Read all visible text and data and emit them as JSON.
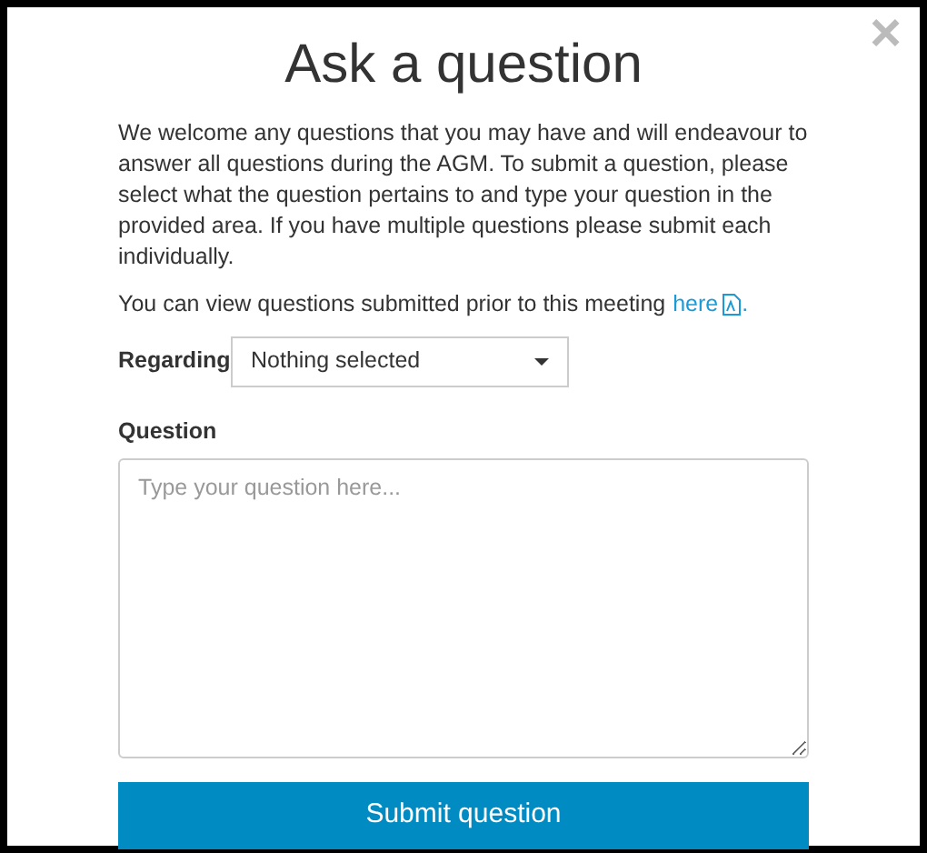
{
  "dialog": {
    "title": "Ask a question",
    "close": "×"
  },
  "intro": "We welcome any questions that you may have and will endeavour to answer all questions during the AGM. To submit a question, please select what the question pertains to and type your question in the provided area. If you have multiple questions please submit each individually.",
  "prior_link": {
    "text": "You can view questions submitted prior to this meeting",
    "link": "here",
    "end": "."
  },
  "regarding": {
    "label": "Regarding",
    "value": "Nothing selected"
  },
  "question": {
    "label": "Question",
    "placeholder": "Type your question here..."
  },
  "submit": "Submit question"
}
